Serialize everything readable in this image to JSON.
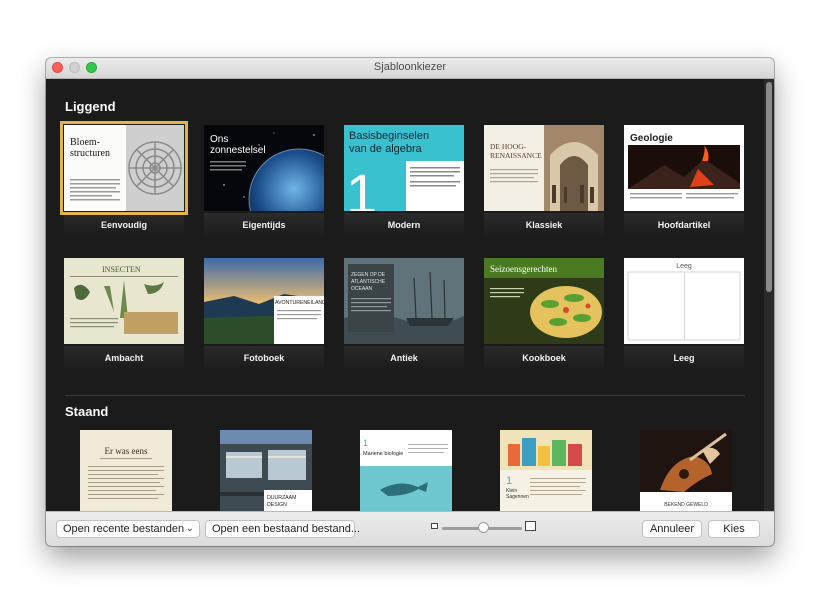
{
  "window": {
    "title": "Sjabloonkiezer"
  },
  "sections": {
    "landscape": "Liggend",
    "portrait": "Staand"
  },
  "templates": [
    {
      "label": "Eenvoudig",
      "heading": "Bloem-\nstructuren",
      "selected": true
    },
    {
      "label": "Eigentijds",
      "heading": "Ons\nzonnestelsel"
    },
    {
      "label": "Modern",
      "heading": "Basisbeginselen\nvan de algebra",
      "number": "1"
    },
    {
      "label": "Klassiek",
      "heading": "DE HOOG-\nRENAISSANCE"
    },
    {
      "label": "Hoofdartikel",
      "heading": "Geologie"
    },
    {
      "label": "Ambacht",
      "heading": "INSECTEN"
    },
    {
      "label": "Fotoboek",
      "heading": "AVONTURENEILAND"
    },
    {
      "label": "Antiek",
      "heading": "ZEGEN OP DE\nATLANTISCHE\nOCEAAN"
    },
    {
      "label": "Kookboek",
      "heading": "Seizoensgerechten"
    },
    {
      "label": "Leeg",
      "heading": "Leeg"
    }
  ],
  "portrait_templates": [
    {
      "heading": "Er was eens"
    },
    {
      "heading": "DUURZAAM\nDESIGN"
    },
    {
      "heading": "Mariene biologie",
      "number": "1"
    },
    {
      "heading": "Klein\nSagennen",
      "number": "1"
    },
    {
      "heading": "BEKEND GEWELD"
    }
  ],
  "footer": {
    "recent_label": "Open recente bestanden",
    "open_label": "Open een bestaand bestand...",
    "cancel_label": "Annuleer",
    "choose_label": "Kies"
  },
  "zoom": {
    "value": 0.45
  },
  "colors": {
    "selected_outline": "#e0b44a",
    "modern_teal": "#39c1cf",
    "content_bg": "#1b1b1b"
  }
}
